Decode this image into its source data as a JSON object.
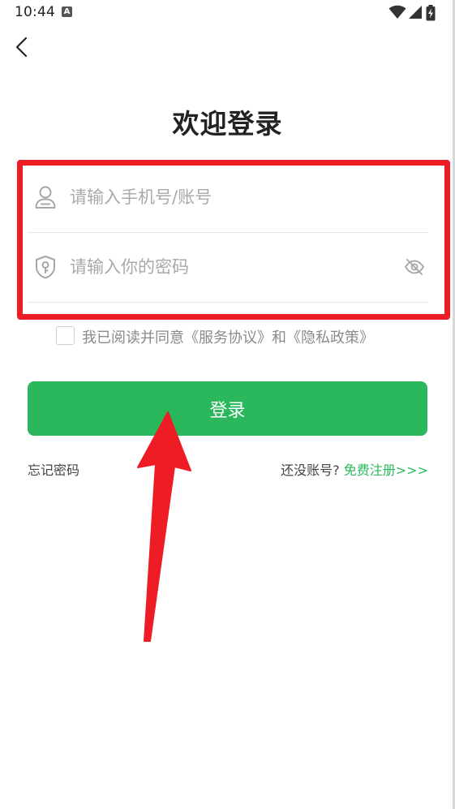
{
  "status_bar": {
    "time": "10:44",
    "notification_icon": "a-icon",
    "icons": [
      "wifi-icon",
      "signal-icon",
      "battery-icon"
    ]
  },
  "header": {
    "back_icon": "chevron-left-icon",
    "title": "欢迎登录"
  },
  "form": {
    "phone": {
      "icon": "user-icon",
      "placeholder": "请输入手机号/账号",
      "value": ""
    },
    "password": {
      "icon": "shield-key-icon",
      "placeholder": "请输入你的密码",
      "value": "",
      "toggle_icon": "eye-hidden-icon"
    }
  },
  "agreement": {
    "checked": false,
    "text": "我已阅读并同意《服务协议》和《隐私政策》"
  },
  "login_button": {
    "label": "登录"
  },
  "links": {
    "forgot_password": "忘记密码",
    "no_account_prompt": "还没账号?",
    "register": "免费注册>>>"
  },
  "colors": {
    "accent": "#2bb85c",
    "annotation": "#ee1c25",
    "placeholder": "#a9a9a9"
  }
}
